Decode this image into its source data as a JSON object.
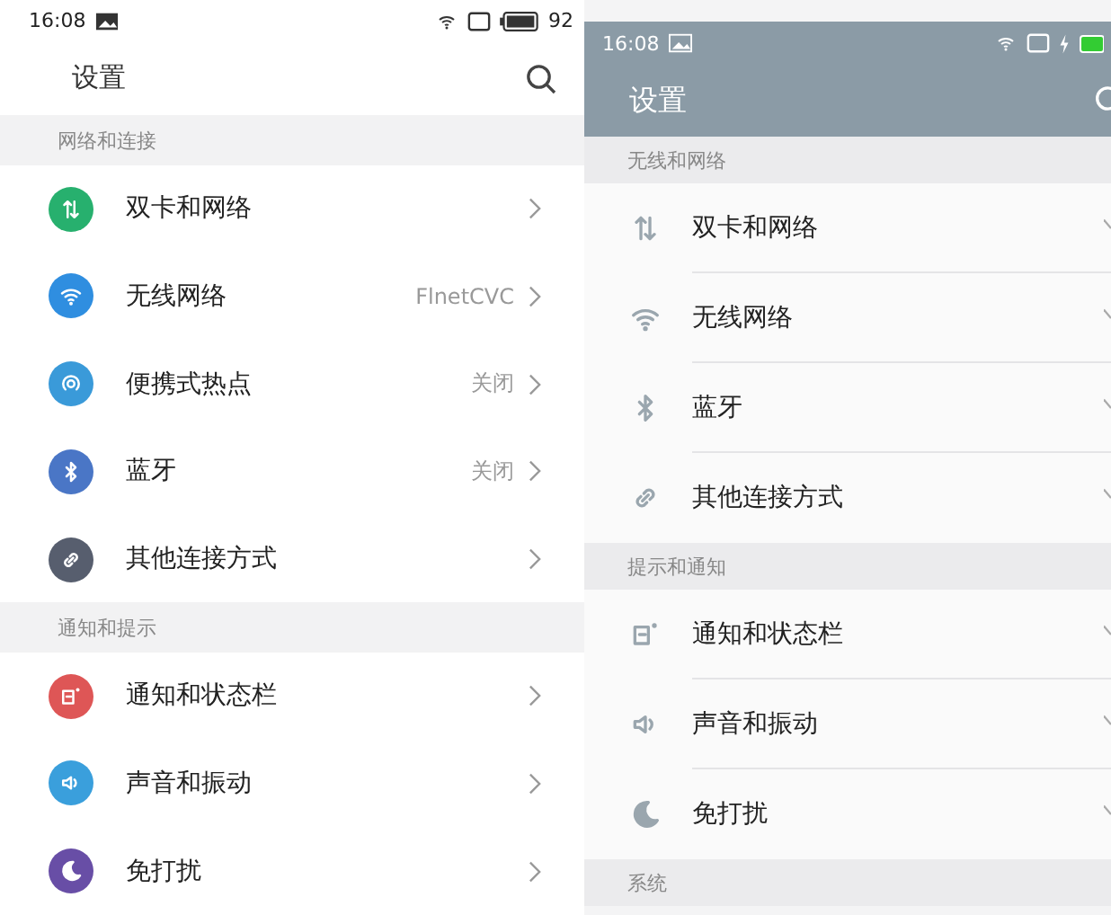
{
  "left": {
    "status_bar": {
      "time": "16:08",
      "battery": "92"
    },
    "title": "设置",
    "sections": [
      {
        "header": "网络和连接",
        "items": [
          {
            "label": "双卡和网络",
            "color": "#27b06e"
          },
          {
            "label": "无线网络",
            "value": "FlnetCVC",
            "color": "#2f8ee0"
          },
          {
            "label": "便携式热点",
            "value": "关闭",
            "color": "#3a9ad9"
          },
          {
            "label": "蓝牙",
            "value": "关闭",
            "color": "#4a76c6"
          },
          {
            "label": "其他连接方式",
            "color": "#575e6e"
          }
        ]
      },
      {
        "header": "通知和提示",
        "items": [
          {
            "label": "通知和状态栏",
            "color": "#de5656"
          },
          {
            "label": "声音和振动",
            "color": "#3a9fdc"
          },
          {
            "label": "免打扰",
            "color": "#684ea6"
          }
        ]
      }
    ]
  },
  "right": {
    "status_bar": {
      "time": "16:08"
    },
    "title": "设置",
    "sections": [
      {
        "header": "无线和网络",
        "items": [
          {
            "label": "双卡和网络"
          },
          {
            "label": "无线网络"
          },
          {
            "label": "蓝牙"
          },
          {
            "label": "其他连接方式"
          }
        ]
      },
      {
        "header": "提示和通知",
        "items": [
          {
            "label": "通知和状态栏"
          },
          {
            "label": "声音和振动"
          },
          {
            "label": "免打扰"
          }
        ]
      },
      {
        "header": "系统"
      }
    ]
  }
}
